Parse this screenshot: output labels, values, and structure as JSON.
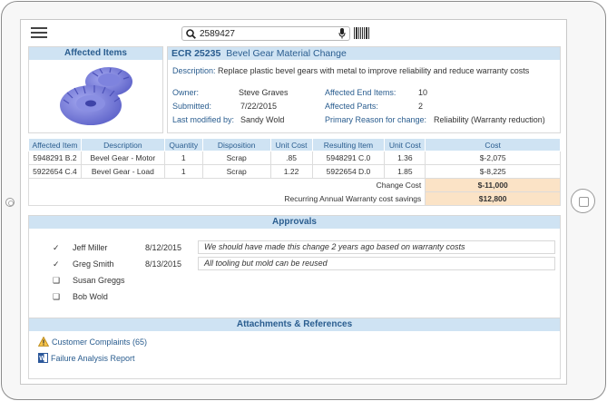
{
  "search": {
    "value": "2589427"
  },
  "affected_items": {
    "title": "Affected Items"
  },
  "ecr": {
    "number": "ECR 25235",
    "title": "Bevel Gear Material Change",
    "description_label": "Description:",
    "description": "Replace plastic bevel gears with metal to improve reliability and reduce warranty costs",
    "owner_label": "Owner:",
    "owner": "Steve Graves",
    "submitted_label": "Submitted:",
    "submitted": "7/22/2015",
    "modified_label": "Last modified by:",
    "modified": "Sandy Wold",
    "end_items_label": "Affected End Items:",
    "end_items": "10",
    "parts_label": "Affected Parts:",
    "parts": "2",
    "reason_label": "Primary Reason for change:",
    "reason": "Reliability (Warranty reduction)"
  },
  "items_table": {
    "headers": [
      "Affected Item",
      "Description",
      "Quantity",
      "Disposition",
      "Unit Cost",
      "Resulting Item",
      "Unit Cost",
      "Cost"
    ],
    "rows": [
      [
        "5948291 B.2",
        "Bevel Gear - Motor",
        "1",
        "Scrap",
        ".85",
        "5948291 C.0",
        "1.36",
        "$-2,075"
      ],
      [
        "5922654 C.4",
        "Bevel Gear - Load",
        "1",
        "Scrap",
        "1.22",
        "5922654 D.0",
        "1.85",
        "$-8,225"
      ]
    ],
    "change_cost_label": "Change Cost",
    "change_cost": "$-11,000",
    "savings_label": "Recurring Annual Warranty cost savings",
    "savings": "$12,800"
  },
  "approvals": {
    "title": "Approvals",
    "rows": [
      {
        "mark": "✓",
        "name": "Jeff Miller",
        "date": "8/12/2015",
        "comment": "We should have made this change 2 years ago based on warranty costs"
      },
      {
        "mark": "✓",
        "name": "Greg Smith",
        "date": "8/13/2015",
        "comment": "All tooling but mold can be reused"
      },
      {
        "mark": "❑",
        "name": "Susan Greggs",
        "date": "",
        "comment": ""
      },
      {
        "mark": "❑",
        "name": "Bob Wold",
        "date": "",
        "comment": ""
      }
    ]
  },
  "attachments": {
    "title": "Attachments & References",
    "items": [
      {
        "icon": "warning-icon",
        "label": "Customer Complaints (65)"
      },
      {
        "icon": "word-doc-icon",
        "label": "Failure Analysis Report"
      }
    ]
  },
  "colors": {
    "header_bg": "#cfe3f3",
    "header_text": "#2a5d8f",
    "cost_highlight": "#fbe3c6"
  }
}
